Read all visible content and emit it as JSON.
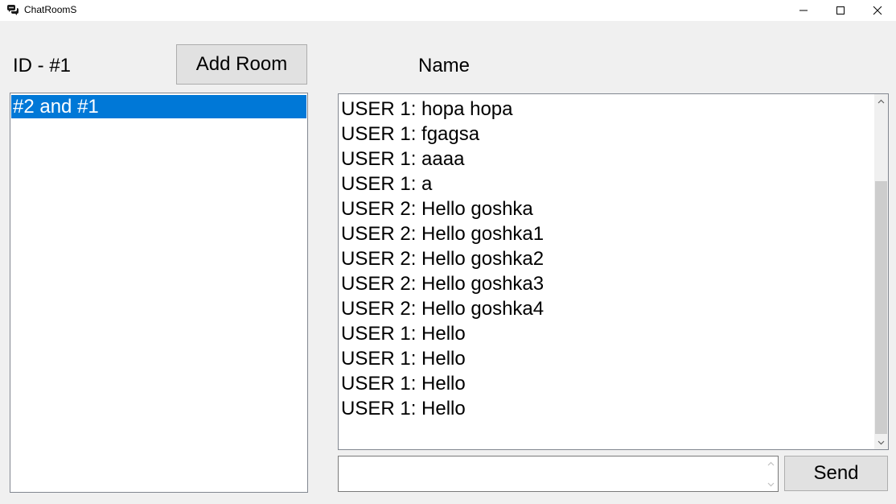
{
  "window": {
    "title": "ChatRoomS",
    "icon": "chat-bubbles-icon",
    "controls": [
      "minimize-icon",
      "maximize-icon",
      "close-icon"
    ]
  },
  "header": {
    "id_label": "ID - #1",
    "add_room_label": "Add Room",
    "name_label": "Name"
  },
  "rooms": {
    "items": [
      {
        "label": "#2 and #1",
        "selected": true
      }
    ]
  },
  "chat": {
    "messages": [
      "USER 1: hopa hopa",
      "USER 1: fgagsa",
      "USER 1: aaaa",
      "USER 1: a",
      "USER 2: Hello goshka",
      "USER 2: Hello goshka1",
      "USER 2: Hello goshka2",
      "USER 2: Hello goshka3",
      "USER 2: Hello goshka4",
      "USER 1: Hello",
      "USER 1: Hello",
      "USER 1: Hello",
      "USER 1: Hello"
    ]
  },
  "composer": {
    "value": "",
    "send_label": "Send"
  },
  "colors": {
    "selection": "#0078d7",
    "window_bg": "#f0f0f0",
    "button_bg": "#e1e1e1"
  }
}
